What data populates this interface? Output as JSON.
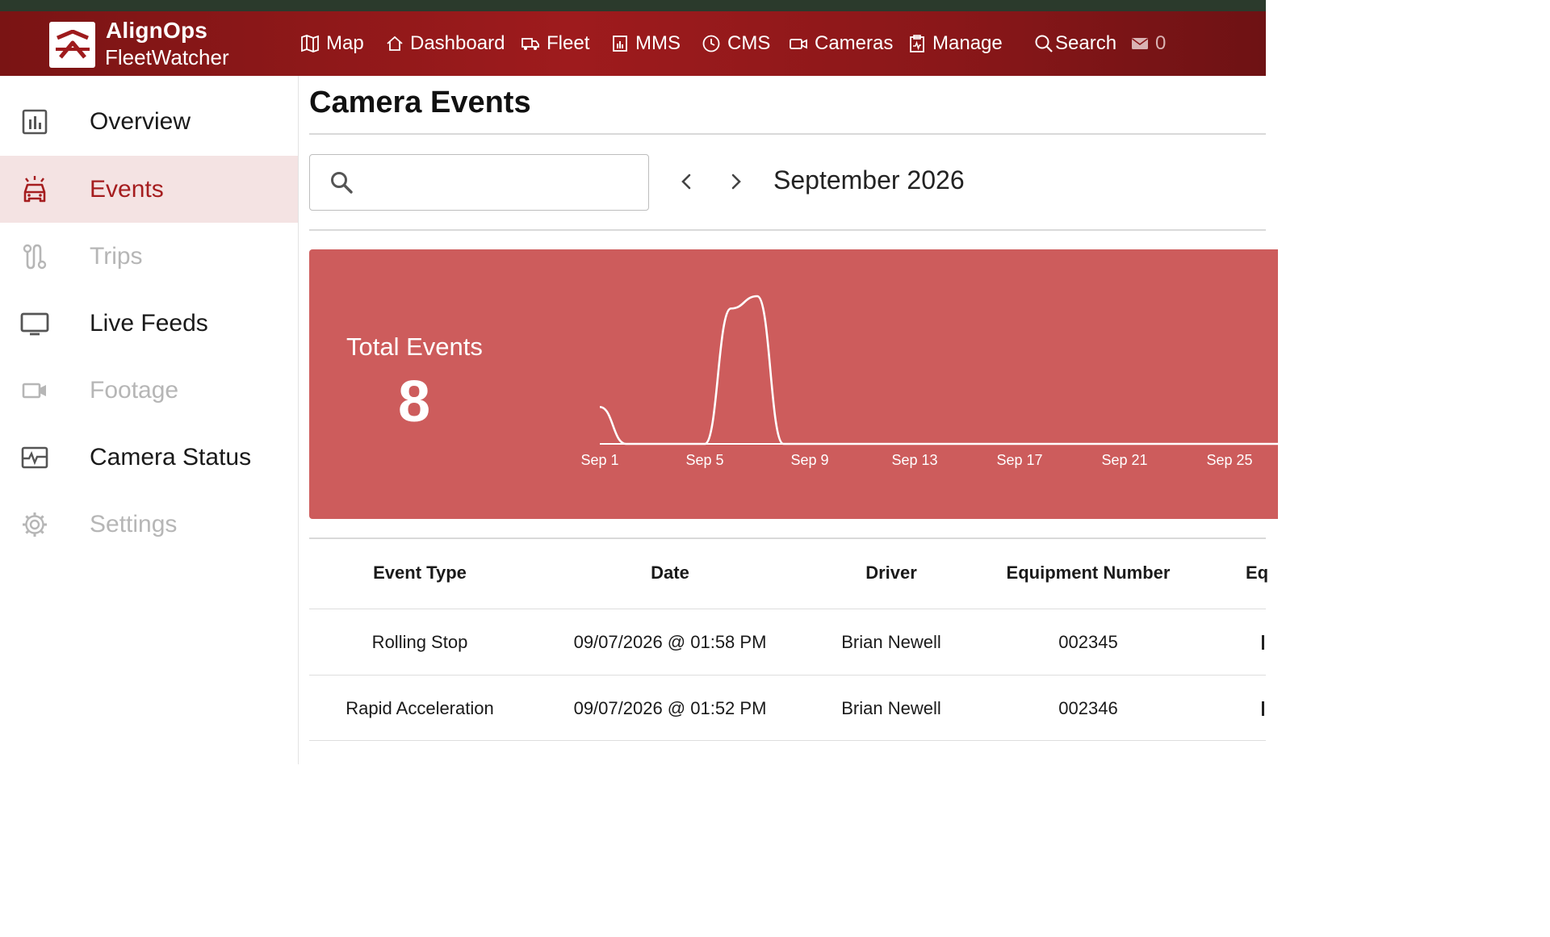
{
  "brand": {
    "name": "AlignOps",
    "product": "FleetWatcher"
  },
  "nav": [
    {
      "label": "Map",
      "icon": "map-icon"
    },
    {
      "label": "Dashboard",
      "icon": "home-icon"
    },
    {
      "label": "Fleet",
      "icon": "truck-icon"
    },
    {
      "label": "MMS",
      "icon": "bar-report-icon"
    },
    {
      "label": "CMS",
      "icon": "clock-icon"
    },
    {
      "label": "Cameras",
      "icon": "video-camera-icon"
    },
    {
      "label": "Manage",
      "icon": "clipboard-icon"
    },
    {
      "label": "Search",
      "icon": "search-icon"
    }
  ],
  "mail_count": "0",
  "sidebar": {
    "items": [
      {
        "label": "Overview",
        "icon": "chart-icon",
        "state": "normal"
      },
      {
        "label": "Events",
        "icon": "car-alert-icon",
        "state": "active"
      },
      {
        "label": "Trips",
        "icon": "route-icon",
        "state": "disabled"
      },
      {
        "label": "Live Feeds",
        "icon": "monitor-icon",
        "state": "normal"
      },
      {
        "label": "Footage",
        "icon": "video-icon",
        "state": "disabled"
      },
      {
        "label": "Camera Status",
        "icon": "pulse-icon",
        "state": "normal"
      },
      {
        "label": "Settings",
        "icon": "gear-icon",
        "state": "disabled"
      }
    ]
  },
  "page": {
    "title": "Camera Events"
  },
  "search": {
    "placeholder": "",
    "value": ""
  },
  "period": {
    "label": "September 2026"
  },
  "summary": {
    "label": "Total Events",
    "value": "8"
  },
  "colors": {
    "header": "#9e1b1d",
    "accent": "#a51d1f",
    "card": "#cd5c5c",
    "active_bg": "#f4e3e3"
  },
  "chart_data": {
    "type": "area",
    "x": [
      "Sep 1",
      "Sep 2",
      "Sep 3",
      "Sep 4",
      "Sep 5",
      "Sep 6",
      "Sep 7",
      "Sep 8",
      "Sep 9",
      "Sep 10",
      "Sep 11",
      "Sep 12",
      "Sep 13",
      "Sep 14",
      "Sep 15",
      "Sep 16",
      "Sep 17",
      "Sep 18",
      "Sep 19",
      "Sep 20",
      "Sep 21",
      "Sep 22",
      "Sep 23",
      "Sep 24",
      "Sep 25",
      "Sep 26",
      "Sep 27",
      "Sep 28",
      "Sep 29",
      "Sep 30"
    ],
    "values": [
      1.5,
      0,
      0,
      0,
      0,
      5.5,
      6,
      0,
      0,
      0,
      0,
      0,
      0,
      0,
      0,
      0,
      0,
      0,
      0,
      0,
      0,
      0,
      0,
      0,
      0,
      0,
      0,
      0,
      0,
      0
    ],
    "tick_labels": [
      "Sep 1",
      "Sep 5",
      "Sep 9",
      "Sep 13",
      "Sep 17",
      "Sep 21",
      "Sep 25"
    ],
    "grid": false,
    "legend": "none"
  },
  "table": {
    "columns": [
      "Event Type",
      "Date",
      "Driver",
      "Equipment Number",
      "Eq"
    ],
    "rows": [
      {
        "event_type": "Rolling Stop",
        "date": "09/07/2026 @ 01:58 PM",
        "driver": "Brian Newell",
        "equipment_number": "002345"
      },
      {
        "event_type": "Rapid Acceleration",
        "date": "09/07/2026 @ 01:52 PM",
        "driver": "Brian Newell",
        "equipment_number": "002346"
      }
    ]
  }
}
